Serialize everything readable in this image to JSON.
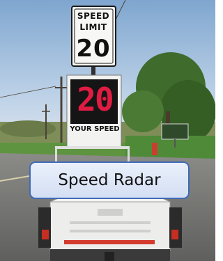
{
  "photo": {
    "sign": {
      "line1": "SPEED",
      "line2": "LIMIT",
      "value": "20"
    },
    "radar_display": {
      "digits": "20",
      "caption": "YOUR SPEED",
      "digit_color": "#e01c43"
    }
  },
  "label": {
    "text": "Speed Radar",
    "border_color": "#3f6ab7",
    "fill_color": "#dbe5f6"
  }
}
